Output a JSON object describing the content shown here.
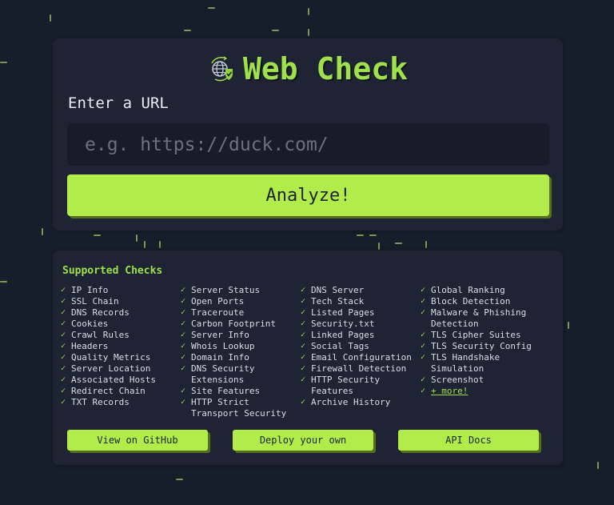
{
  "app": {
    "title": "Web Check",
    "logo_icon": "globe-shield-check-icon"
  },
  "url_form": {
    "label": "Enter a URL",
    "input_value": "",
    "input_placeholder": "e.g. https://duck.com/",
    "analyze_label": "Analyze!"
  },
  "checks": {
    "heading": "Supported Checks",
    "tick_icon": "checkmark-icon",
    "columns": [
      [
        "IP Info",
        "SSL Chain",
        "DNS Records",
        "Cookies",
        "Crawl Rules",
        "Headers",
        "Quality Metrics",
        "Server Location",
        "Associated Hosts",
        "Redirect Chain",
        "TXT Records"
      ],
      [
        "Server Status",
        "Open Ports",
        "Traceroute",
        "Carbon Footprint",
        "Server Info",
        "Whois Lookup",
        "Domain Info",
        "DNS Security Extensions",
        "Site Features",
        "HTTP Strict Transport Security"
      ],
      [
        "DNS Server",
        "Tech Stack",
        "Listed Pages",
        "Security.txt",
        "Linked Pages",
        "Social Tags",
        "Email Configuration",
        "Firewall Detection",
        "HTTP Security Features",
        "Archive History"
      ],
      [
        "Global Ranking",
        "Block Detection",
        "Malware & Phishing Detection",
        "TLS Cipher Suites",
        "TLS Security Config",
        "TLS Handshake Simulation",
        "Screenshot"
      ]
    ],
    "more_link": "+ more!"
  },
  "footer_buttons": {
    "github": "View on GitHub",
    "deploy": "Deploy your own",
    "api_docs": "API Docs"
  },
  "colors": {
    "accent": "#b2ec4a",
    "title": "#9fe14c",
    "background": "#171e2b",
    "card": "#1e2433"
  }
}
